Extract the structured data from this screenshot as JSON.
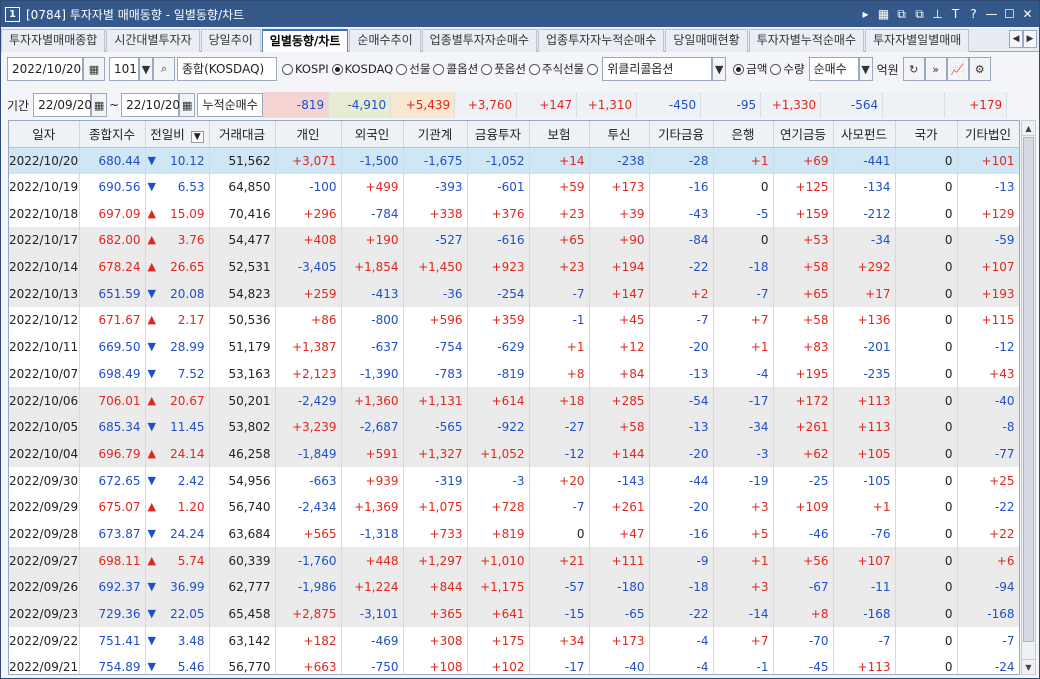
{
  "window": {
    "number": "1",
    "title": "[0784] 투자자별 매매동향 - 일별동향/차트"
  },
  "tabs": [
    "투자자별매매종합",
    "시간대별투자자",
    "당일추이",
    "일별동향/차트",
    "순매수추이",
    "업종별투자자순매수",
    "업종투자자누적순매수",
    "당일매매현황",
    "투자자별누적순매수",
    "투자자별일별매매"
  ],
  "active_tab": 3,
  "toolbar": {
    "date": "2022/10/20",
    "code": "101",
    "market_label": "종합(KOSDAQ)",
    "market_radios": [
      {
        "label": "KOSPI",
        "on": false
      },
      {
        "label": "KOSDAQ",
        "on": true
      },
      {
        "label": "선물",
        "on": false
      },
      {
        "label": "콜옵션",
        "on": false
      },
      {
        "label": "풋옵션",
        "on": false
      },
      {
        "label": "주식선물",
        "on": false
      },
      {
        "label": "",
        "on": false
      }
    ],
    "weekly_option": "위클리콜옵션",
    "unit_radios": [
      {
        "label": "금액",
        "on": true
      },
      {
        "label": "수량",
        "on": false
      }
    ],
    "net_select": "순매수",
    "unit_label": "억원"
  },
  "filter": {
    "period_label": "기간",
    "start_date": "22/09/20",
    "tilde": "~",
    "end_date": "22/10/20",
    "cum_label": "누적순매수",
    "cum_values": [
      "-819",
      "-4,910",
      "+5,439",
      "+3,760",
      "+147",
      "+1,310",
      "-450",
      "-95",
      "+1,330",
      "-564",
      "",
      "+179"
    ]
  },
  "columns": [
    "일자",
    "종합지수",
    "전일비",
    "거래대금",
    "개인",
    "외국인",
    "기관계",
    "금융투자",
    "보험",
    "투신",
    "기타금융",
    "은행",
    "연기금등",
    "사모펀드",
    "국가",
    "기타법인"
  ],
  "rows": [
    [
      "2022/10/20",
      "680.44",
      "dn",
      "10.12",
      "51,562",
      "+3,071",
      "-1,500",
      "-1,675",
      "-1,052",
      "+14",
      "-238",
      "-28",
      "+1",
      "+69",
      "-441",
      "0",
      "+101"
    ],
    [
      "2022/10/19",
      "690.56",
      "dn",
      "6.53",
      "64,850",
      "-100",
      "+499",
      "-393",
      "-601",
      "+59",
      "+173",
      "-16",
      "0",
      "+125",
      "-134",
      "0",
      "-13"
    ],
    [
      "2022/10/18",
      "697.09",
      "up",
      "15.09",
      "70,416",
      "+296",
      "-784",
      "+338",
      "+376",
      "+23",
      "+39",
      "-43",
      "-5",
      "+159",
      "-212",
      "0",
      "+129"
    ],
    [
      "2022/10/17",
      "682.00",
      "up",
      "3.76",
      "54,477",
      "+408",
      "+190",
      "-527",
      "-616",
      "+65",
      "+90",
      "-84",
      "0",
      "+53",
      "-34",
      "0",
      "-59"
    ],
    [
      "2022/10/14",
      "678.24",
      "up",
      "26.65",
      "52,531",
      "-3,405",
      "+1,854",
      "+1,450",
      "+923",
      "+23",
      "+194",
      "-22",
      "-18",
      "+58",
      "+292",
      "0",
      "+107"
    ],
    [
      "2022/10/13",
      "651.59",
      "dn",
      "20.08",
      "54,823",
      "+259",
      "-413",
      "-36",
      "-254",
      "-7",
      "+147",
      "+2",
      "-7",
      "+65",
      "+17",
      "0",
      "+193"
    ],
    [
      "2022/10/12",
      "671.67",
      "up",
      "2.17",
      "50,536",
      "+86",
      "-800",
      "+596",
      "+359",
      "-1",
      "+45",
      "-7",
      "+7",
      "+58",
      "+136",
      "0",
      "+115"
    ],
    [
      "2022/10/11",
      "669.50",
      "dn",
      "28.99",
      "51,179",
      "+1,387",
      "-637",
      "-754",
      "-629",
      "+1",
      "+12",
      "-20",
      "+1",
      "+83",
      "-201",
      "0",
      "-12"
    ],
    [
      "2022/10/07",
      "698.49",
      "dn",
      "7.52",
      "53,163",
      "+2,123",
      "-1,390",
      "-783",
      "-819",
      "+8",
      "+84",
      "-13",
      "-4",
      "+195",
      "-235",
      "0",
      "+43"
    ],
    [
      "2022/10/06",
      "706.01",
      "up",
      "20.67",
      "50,201",
      "-2,429",
      "+1,360",
      "+1,131",
      "+614",
      "+18",
      "+285",
      "-54",
      "-17",
      "+172",
      "+113",
      "0",
      "-40"
    ],
    [
      "2022/10/05",
      "685.34",
      "dn",
      "11.45",
      "53,802",
      "+3,239",
      "-2,687",
      "-565",
      "-922",
      "-27",
      "+58",
      "-13",
      "-34",
      "+261",
      "+113",
      "0",
      "-8"
    ],
    [
      "2022/10/04",
      "696.79",
      "up",
      "24.14",
      "46,258",
      "-1,849",
      "+591",
      "+1,327",
      "+1,052",
      "-12",
      "+144",
      "-20",
      "-3",
      "+62",
      "+105",
      "0",
      "-77"
    ],
    [
      "2022/09/30",
      "672.65",
      "dn",
      "2.42",
      "54,956",
      "-663",
      "+939",
      "-319",
      "-3",
      "+20",
      "-143",
      "-44",
      "-19",
      "-25",
      "-105",
      "0",
      "+25"
    ],
    [
      "2022/09/29",
      "675.07",
      "up",
      "1.20",
      "56,740",
      "-2,434",
      "+1,369",
      "+1,075",
      "+728",
      "-7",
      "+261",
      "-20",
      "+3",
      "+109",
      "+1",
      "0",
      "-22"
    ],
    [
      "2022/09/28",
      "673.87",
      "dn",
      "24.24",
      "63,684",
      "+565",
      "-1,318",
      "+733",
      "+819",
      "0",
      "+47",
      "-16",
      "+5",
      "-46",
      "-76",
      "0",
      "+22"
    ],
    [
      "2022/09/27",
      "698.11",
      "up",
      "5.74",
      "60,339",
      "-1,760",
      "+448",
      "+1,297",
      "+1,010",
      "+21",
      "+111",
      "-9",
      "+1",
      "+56",
      "+107",
      "0",
      "+6"
    ],
    [
      "2022/09/26",
      "692.37",
      "dn",
      "36.99",
      "62,777",
      "-1,986",
      "+1,224",
      "+844",
      "+1,175",
      "-57",
      "-180",
      "-18",
      "+3",
      "-67",
      "-11",
      "0",
      "-94"
    ],
    [
      "2022/09/23",
      "729.36",
      "dn",
      "22.05",
      "65,458",
      "+2,875",
      "-3,101",
      "+365",
      "+641",
      "-15",
      "-65",
      "-22",
      "-14",
      "+8",
      "-168",
      "0",
      "-168"
    ],
    [
      "2022/09/22",
      "751.41",
      "dn",
      "3.48",
      "63,142",
      "+182",
      "-469",
      "+308",
      "+175",
      "+34",
      "+173",
      "-4",
      "+7",
      "-70",
      "-7",
      "0",
      "-7"
    ],
    [
      "2022/09/21",
      "754.89",
      "dn",
      "5.46",
      "56,770",
      "+663",
      "-750",
      "+108",
      "+102",
      "-17",
      "-40",
      "-4",
      "-1",
      "-45",
      "+113",
      "0",
      "-24"
    ]
  ],
  "colors": {
    "up": "#e0261d",
    "down": "#1e4fc7",
    "selected_row": "#cfe6f5",
    "alt_row": "#ebebeb",
    "title_bar": "#35588a"
  }
}
